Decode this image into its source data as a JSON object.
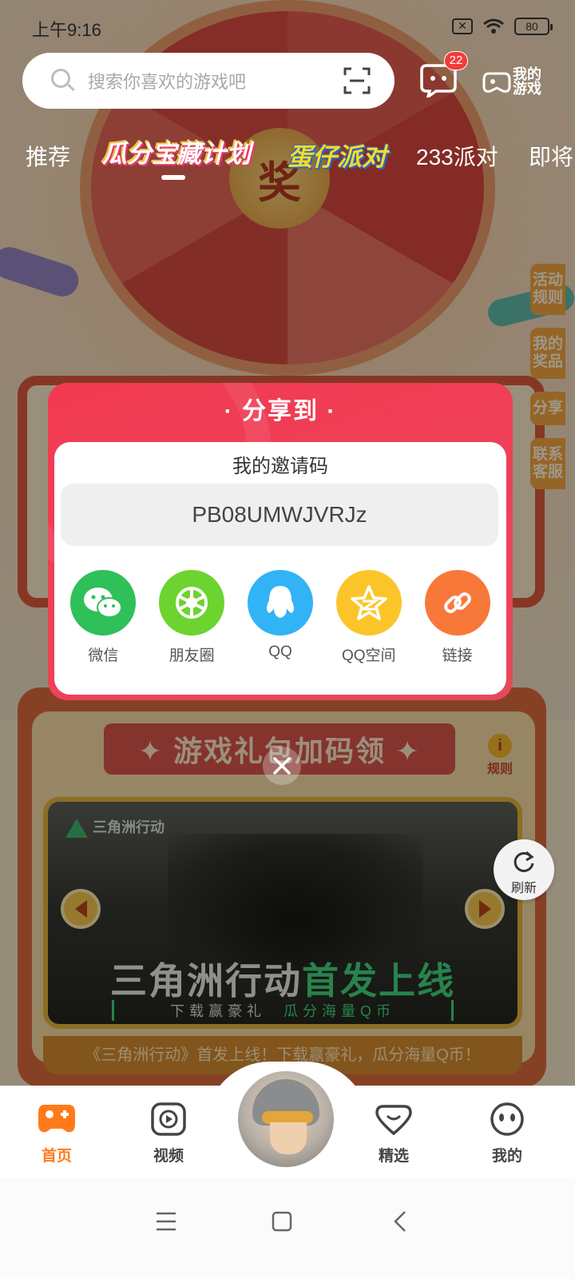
{
  "status_bar": {
    "time": "上午9:16",
    "battery": "80"
  },
  "search": {
    "placeholder": "搜索你喜欢的游戏吧"
  },
  "header": {
    "message_badge": "22",
    "my_games_label": "我的游戏"
  },
  "tabs": [
    {
      "label": "推荐"
    },
    {
      "label": "瓜分宝藏计划"
    },
    {
      "label": "蛋仔派对"
    },
    {
      "label": "233派对"
    },
    {
      "label": "即将"
    }
  ],
  "background": {
    "wheel_hub_label": "奖",
    "side_tabs": [
      "活动规则",
      "我的奖品",
      "分享",
      "联系客服"
    ],
    "banner_title": "✦ 游戏礼包加码领 ✦",
    "rules_label": "规则",
    "game_logo": "三角洲行动",
    "game_title_main": "三角洲行动",
    "game_title_highlight": "首发上线",
    "game_sub_a": "下载赢豪礼",
    "game_sub_b": "瓜分海量Q币",
    "game_caption": "《三角洲行动》首发上线！下载赢豪礼，瓜分海量Q币！",
    "refresh_label": "刷新"
  },
  "share_dialog": {
    "title": "· 分享到 ·",
    "invite_label": "我的邀请码",
    "invite_code": "PB08UMWJVRJz",
    "options": [
      {
        "label": "微信",
        "icon": "wechat-icon",
        "color": "#2fc05a"
      },
      {
        "label": "朋友圈",
        "icon": "moments-icon",
        "color": "#6cd32f"
      },
      {
        "label": "QQ",
        "icon": "qq-icon",
        "color": "#31b3f5"
      },
      {
        "label": "QQ空间",
        "icon": "qzone-icon",
        "color": "#fbc52a"
      },
      {
        "label": "链接",
        "icon": "link-icon",
        "color": "#f8783a"
      }
    ]
  },
  "bottom_nav": {
    "items": [
      {
        "label": "首页",
        "icon": "gamepad-icon",
        "active": true
      },
      {
        "label": "视频",
        "icon": "video-icon",
        "active": false
      },
      {
        "label": "精选",
        "icon": "heart-icon",
        "active": false
      },
      {
        "label": "我的",
        "icon": "face-icon",
        "active": false
      }
    ]
  },
  "colors": {
    "accent": "#ff7a1a",
    "dialog": "#f13a52"
  }
}
